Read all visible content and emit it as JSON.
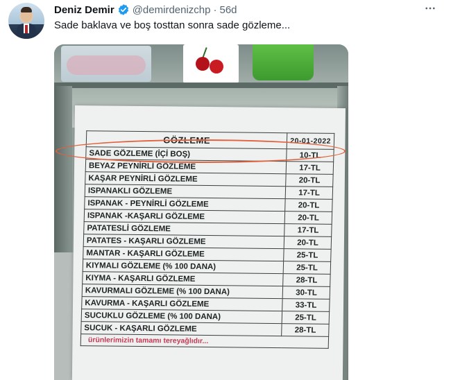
{
  "author": {
    "name": "Deniz Demir",
    "handle": "@demirdenizchp",
    "separator": "·",
    "age": "56d"
  },
  "tweet_text": "Sade baklava ve boş tosttan sonra sade gözleme...",
  "menu": {
    "title": "GÖZLEME",
    "date": "20-01-2022",
    "items": [
      {
        "name": "SADE GÖZLEME (İÇİ BOŞ)",
        "price": "10-TL"
      },
      {
        "name": "BEYAZ PEYNİRLİ GÖZLEME",
        "price": "17-TL"
      },
      {
        "name": "KAŞAR PEYNİRLİ GÖZLEME",
        "price": "20-TL"
      },
      {
        "name": "ISPANAKLI GÖZLEME",
        "price": "17-TL"
      },
      {
        "name": "ISPANAK - PEYNİRLİ GÖZLEME",
        "price": "20-TL"
      },
      {
        "name": "ISPANAK -KAŞARLI GÖZLEME",
        "price": "20-TL"
      },
      {
        "name": "PATATESLİ GÖZLEME",
        "price": "17-TL"
      },
      {
        "name": "PATATES - KAŞARLI GÖZLEME",
        "price": "20-TL"
      },
      {
        "name": "MANTAR - KAŞARLI GÖZLEME",
        "price": "25-TL"
      },
      {
        "name": "KIYMALI GÖZLEME (% 100 DANA)",
        "price": "25-TL"
      },
      {
        "name": "KIYMA - KAŞARLI GÖZLEME",
        "price": "28-TL"
      },
      {
        "name": "KAVURMALI GÖZLEME (% 100 DANA)",
        "price": "30-TL"
      },
      {
        "name": "KAVURMA - KAŞARLI GÖZLEME",
        "price": "33-TL"
      },
      {
        "name": "SUCUKLU GÖZLEME (% 100 DANA)",
        "price": "25-TL"
      },
      {
        "name": "SUCUK - KAŞARLI GÖZLEME",
        "price": "28-TL"
      }
    ],
    "footnote": "ürünlerimizin tamamı tereyağlıdır..."
  },
  "colors": {
    "verified_blue": "#1d9bf0",
    "highlight_oval": "#e0623f"
  },
  "icons": {
    "verified": "verified-badge-icon",
    "more": "more-options-icon"
  }
}
